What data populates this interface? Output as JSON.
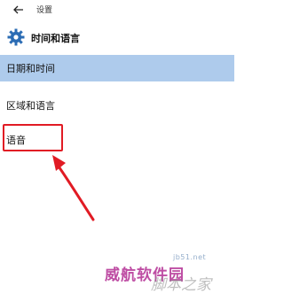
{
  "window": {
    "back_icon": "arrow-left-icon",
    "title": "设置"
  },
  "header": {
    "icon": "gear-icon",
    "title": "时间和语言"
  },
  "nav": {
    "items": [
      {
        "label": "日期和时间",
        "selected": true
      },
      {
        "label": "区域和语言",
        "selected": false
      },
      {
        "label": "语音",
        "selected": false
      }
    ]
  },
  "annotation": {
    "highlight_color": "#e11b24",
    "target": "语音"
  },
  "watermark": {
    "main": "威航软件园",
    "url": "jb51.net",
    "sub": "脚本之家"
  },
  "colors": {
    "selected_bg": "#aecbec",
    "accent": "#2b6cb4"
  }
}
